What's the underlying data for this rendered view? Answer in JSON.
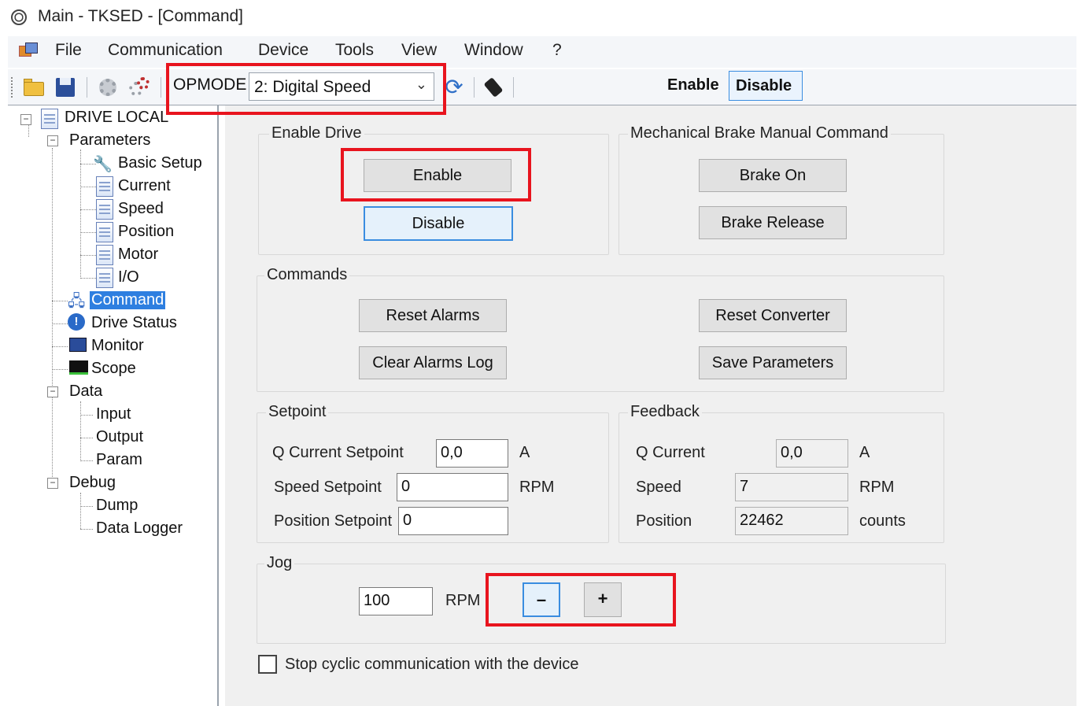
{
  "window": {
    "title": "Main - TKSED - [Command]"
  },
  "menu": {
    "items": [
      "File",
      "Communication",
      "Device",
      "Tools",
      "View",
      "Window",
      "?"
    ]
  },
  "toolbar": {
    "icons": [
      "open-folder-icon",
      "save-icon",
      "gear-icon",
      "gears-icon",
      "refresh-icon",
      "plug-icon"
    ],
    "opmode_label": "OPMODE",
    "opmode_value": "2: Digital Speed",
    "enable_label": "Enable",
    "disable_label": "Disable"
  },
  "tree": {
    "root": "DRIVE LOCAL",
    "parameters": "Parameters",
    "parameter_items": [
      "Basic Setup",
      "Current",
      "Speed",
      "Position",
      "Motor",
      "I/O"
    ],
    "command": "Command",
    "drive_status": "Drive Status",
    "monitor": "Monitor",
    "scope": "Scope",
    "data": "Data",
    "data_items": [
      "Input",
      "Output",
      "Param"
    ],
    "debug": "Debug",
    "debug_items": [
      "Dump",
      "Data Logger"
    ]
  },
  "enable_drive": {
    "title": "Enable Drive",
    "enable": "Enable",
    "disable": "Disable"
  },
  "brake": {
    "title": "Mechanical Brake Manual Command",
    "brake_on": "Brake On",
    "brake_release": "Brake Release"
  },
  "commands": {
    "title": "Commands",
    "reset_alarms": "Reset Alarms",
    "clear_alarms_log": "Clear Alarms Log",
    "reset_converter": "Reset Converter",
    "save_parameters": "Save Parameters"
  },
  "setpoint": {
    "title": "Setpoint",
    "rows": [
      {
        "label": "Q Current Setpoint",
        "value": "0,0",
        "unit": "A"
      },
      {
        "label": "Speed Setpoint",
        "value": "0",
        "unit": "RPM"
      },
      {
        "label": "Position Setpoint",
        "value": "0",
        "unit": ""
      }
    ]
  },
  "feedback": {
    "title": "Feedback",
    "rows": [
      {
        "label": "Q Current",
        "value": "0,0",
        "unit": "A"
      },
      {
        "label": "Speed",
        "value": "7",
        "unit": "RPM"
      },
      {
        "label": "Position",
        "value": "22462",
        "unit": "counts"
      }
    ]
  },
  "jog": {
    "title": "Jog",
    "value": "100",
    "unit": "RPM",
    "minus": "–",
    "plus": "+"
  },
  "footer": {
    "stop_cyclic_label": "Stop cyclic communication with the device",
    "stop_cyclic_checked": false
  },
  "colors": {
    "highlight": "#e8141e",
    "selection": "#2e7fe0",
    "focus_border": "#3a8de0"
  }
}
